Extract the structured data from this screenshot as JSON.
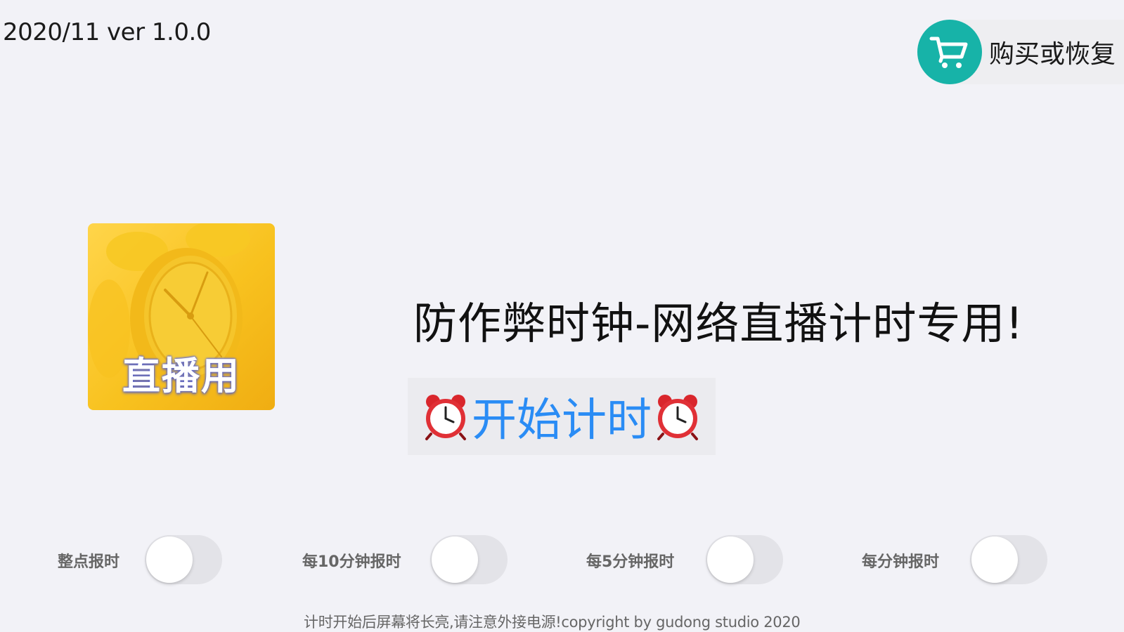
{
  "version_text": "2020/11 ver 1.0.0",
  "purchase": {
    "label": "购买或恢复",
    "icon": "shopping-cart-icon",
    "color": "#17b3a8"
  },
  "app_icon": {
    "caption": "直播用",
    "icon": "alarm-clock-icon",
    "color": "#f8c21f"
  },
  "title": "防作弊时钟-网络直播计时专用!",
  "start_button": {
    "label": "开始计时",
    "icon": "alarm-clock-emoji",
    "color": "#2a8cf5"
  },
  "toggles": [
    {
      "label": "整点报时",
      "on": false
    },
    {
      "label": "每10分钟报时",
      "on": false
    },
    {
      "label": "每5分钟报时",
      "on": false
    },
    {
      "label": "每分钟报时",
      "on": false
    }
  ],
  "footer": "计时开始后屏幕将长亮,请注意外接电源!copyright by gudong studio 2020"
}
